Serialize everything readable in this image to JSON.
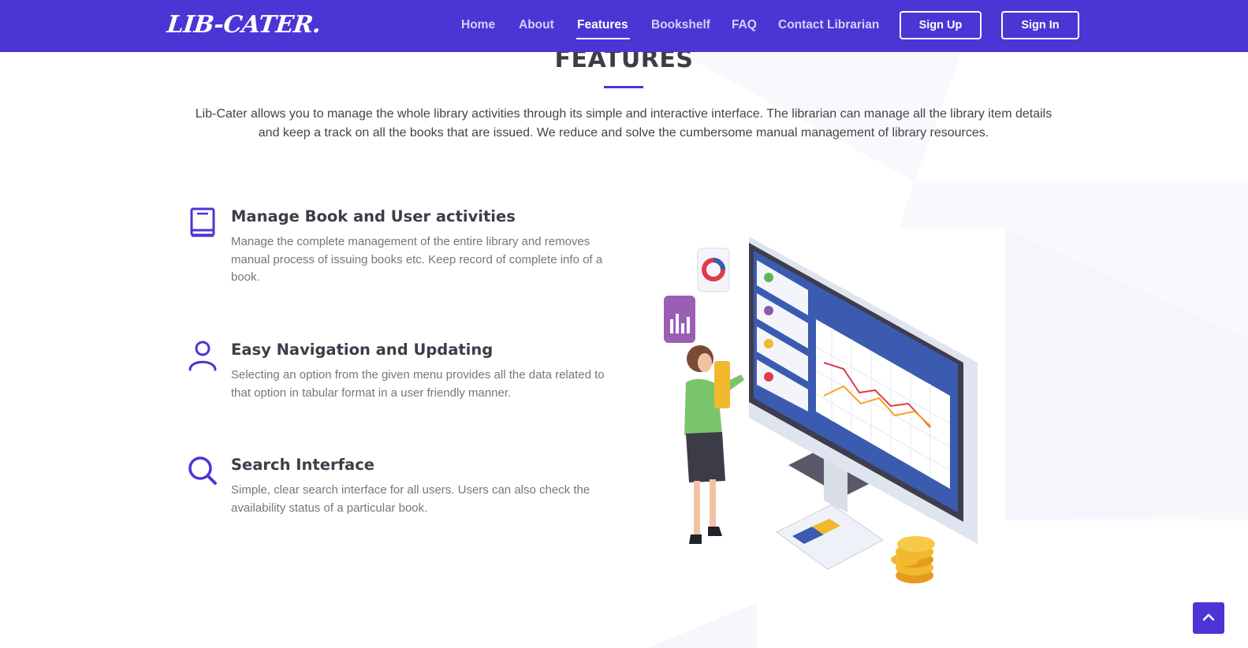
{
  "app": {
    "logo": "LIB-CATER."
  },
  "nav": {
    "items": [
      {
        "label": "Home",
        "active": false
      },
      {
        "label": "About",
        "active": false
      },
      {
        "label": "Features",
        "active": true
      },
      {
        "label": "Bookshelf",
        "active": false
      },
      {
        "label": "FAQ",
        "active": false
      },
      {
        "label": "Contact Librarian",
        "active": false
      }
    ],
    "signup_label": "Sign Up",
    "signin_label": "Sign In"
  },
  "section": {
    "title": "FEATURES",
    "intro": "Lib-Cater allows you to manage the whole library activities through its simple and interactive interface. The librarian can manage all the library item details and keep a track on all the books that are issued. We reduce and solve the cumbersome manual management of library resources."
  },
  "features": [
    {
      "icon": "book-icon",
      "title": "Manage Book and User activities",
      "description": "Manage the complete management of the entire library and removes manual process of issuing books etc. Keep record of complete info of a book."
    },
    {
      "icon": "user-icon",
      "title": "Easy Navigation and Updating",
      "description": "Selecting an option from the given menu provides all the data related to that option in tabular format in a user friendly manner."
    },
    {
      "icon": "search-icon",
      "title": "Search Interface",
      "description": "Simple, clear search interface for all users. Users can also check the availability status of a particular book."
    }
  ],
  "scroll_top": {
    "icon": "chevron-up-icon"
  },
  "colors": {
    "brand": "#4b35d4",
    "heading": "#3d3d4a",
    "text": "#777777"
  }
}
